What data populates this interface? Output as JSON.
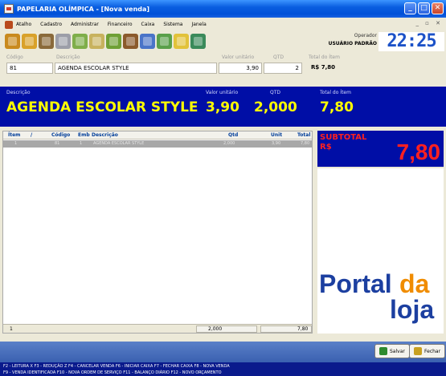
{
  "window": {
    "title": "PAPELARIA OLÍMPICA - [Nova venda]"
  },
  "menu": [
    "Atalho",
    "Cadastro",
    "Administrar",
    "Financeiro",
    "Caixa",
    "Sistema",
    "Janela"
  ],
  "toolbar_icons": [
    "users-icon",
    "people-icon",
    "boxes-icon",
    "pencil-icon",
    "tools-icon",
    "paint-icon",
    "money-icon",
    "folder-icon",
    "envelope-icon",
    "chart-icon",
    "note-icon",
    "exit-icon"
  ],
  "operator": {
    "label": "Operador",
    "name": "USUÁRIO PADRÃO"
  },
  "clock": "22:25",
  "entry": {
    "codigo_label": "Código",
    "descricao_label": "Descrição",
    "valor_label": "Valor unitário",
    "qtd_label": "QTD",
    "total_label": "Total do Ítem",
    "codigo": "81",
    "descricao": "AGENDA ESCOLAR STYLE",
    "valor": "3,90",
    "qtd": "2",
    "total": "R$ 7,80"
  },
  "panel": {
    "descricao_label": "Descrição",
    "valor_label": "Valor unitário",
    "qtd_label": "QTD",
    "total_label": "Total do Ítem",
    "descricao": "AGENDA ESCOLAR STYLE",
    "valor": "3,90",
    "qtd": "2,000",
    "total": "7,80"
  },
  "grid": {
    "headers": [
      "Ítem",
      "/",
      "Código",
      "Emb",
      "Descrição",
      "Qtd",
      "Unit",
      "Total"
    ],
    "rows": [
      {
        "item": "1",
        "codigo": "81",
        "emb": "1",
        "descricao": "AGENDA ESCOLAR STYLE",
        "qtd": "2,000",
        "unit": "3,90",
        "total": "7,80"
      }
    ],
    "footer": {
      "count": "1",
      "qtd": "2,000",
      "total": "7,80"
    }
  },
  "subtotal": {
    "label1": "SUBTOTAL",
    "label2": "R$",
    "value": "7,80"
  },
  "logo": {
    "line1a": "Portal",
    "line1b": "da",
    "line2": "loja"
  },
  "buttons": {
    "salvar": "Salvar",
    "fechar": "Fechar"
  },
  "shortcuts": {
    "line1": "F2 - LEITURA X     F3 - REDUÇÃO Z     F4 - CANCELAR VENDA     F6 - INICIAR CAIXA     F7 - FECHAR CAIXA     F8 - NOVA VENDA",
    "line2": "F9 - VENDA IDENTIFICADA     F10 - NOVA ORDEM DE SERVIÇO     F11 - BALANÇO DIÁRIO     F12 - NOVO ORÇAMENTO"
  },
  "colors": {
    "panel_blue": "#000ea6",
    "accent_yellow": "#ffff00",
    "subtotal_red": "#ff2020",
    "logo_blue": "#1c3fa0",
    "logo_orange": "#f08c00"
  }
}
